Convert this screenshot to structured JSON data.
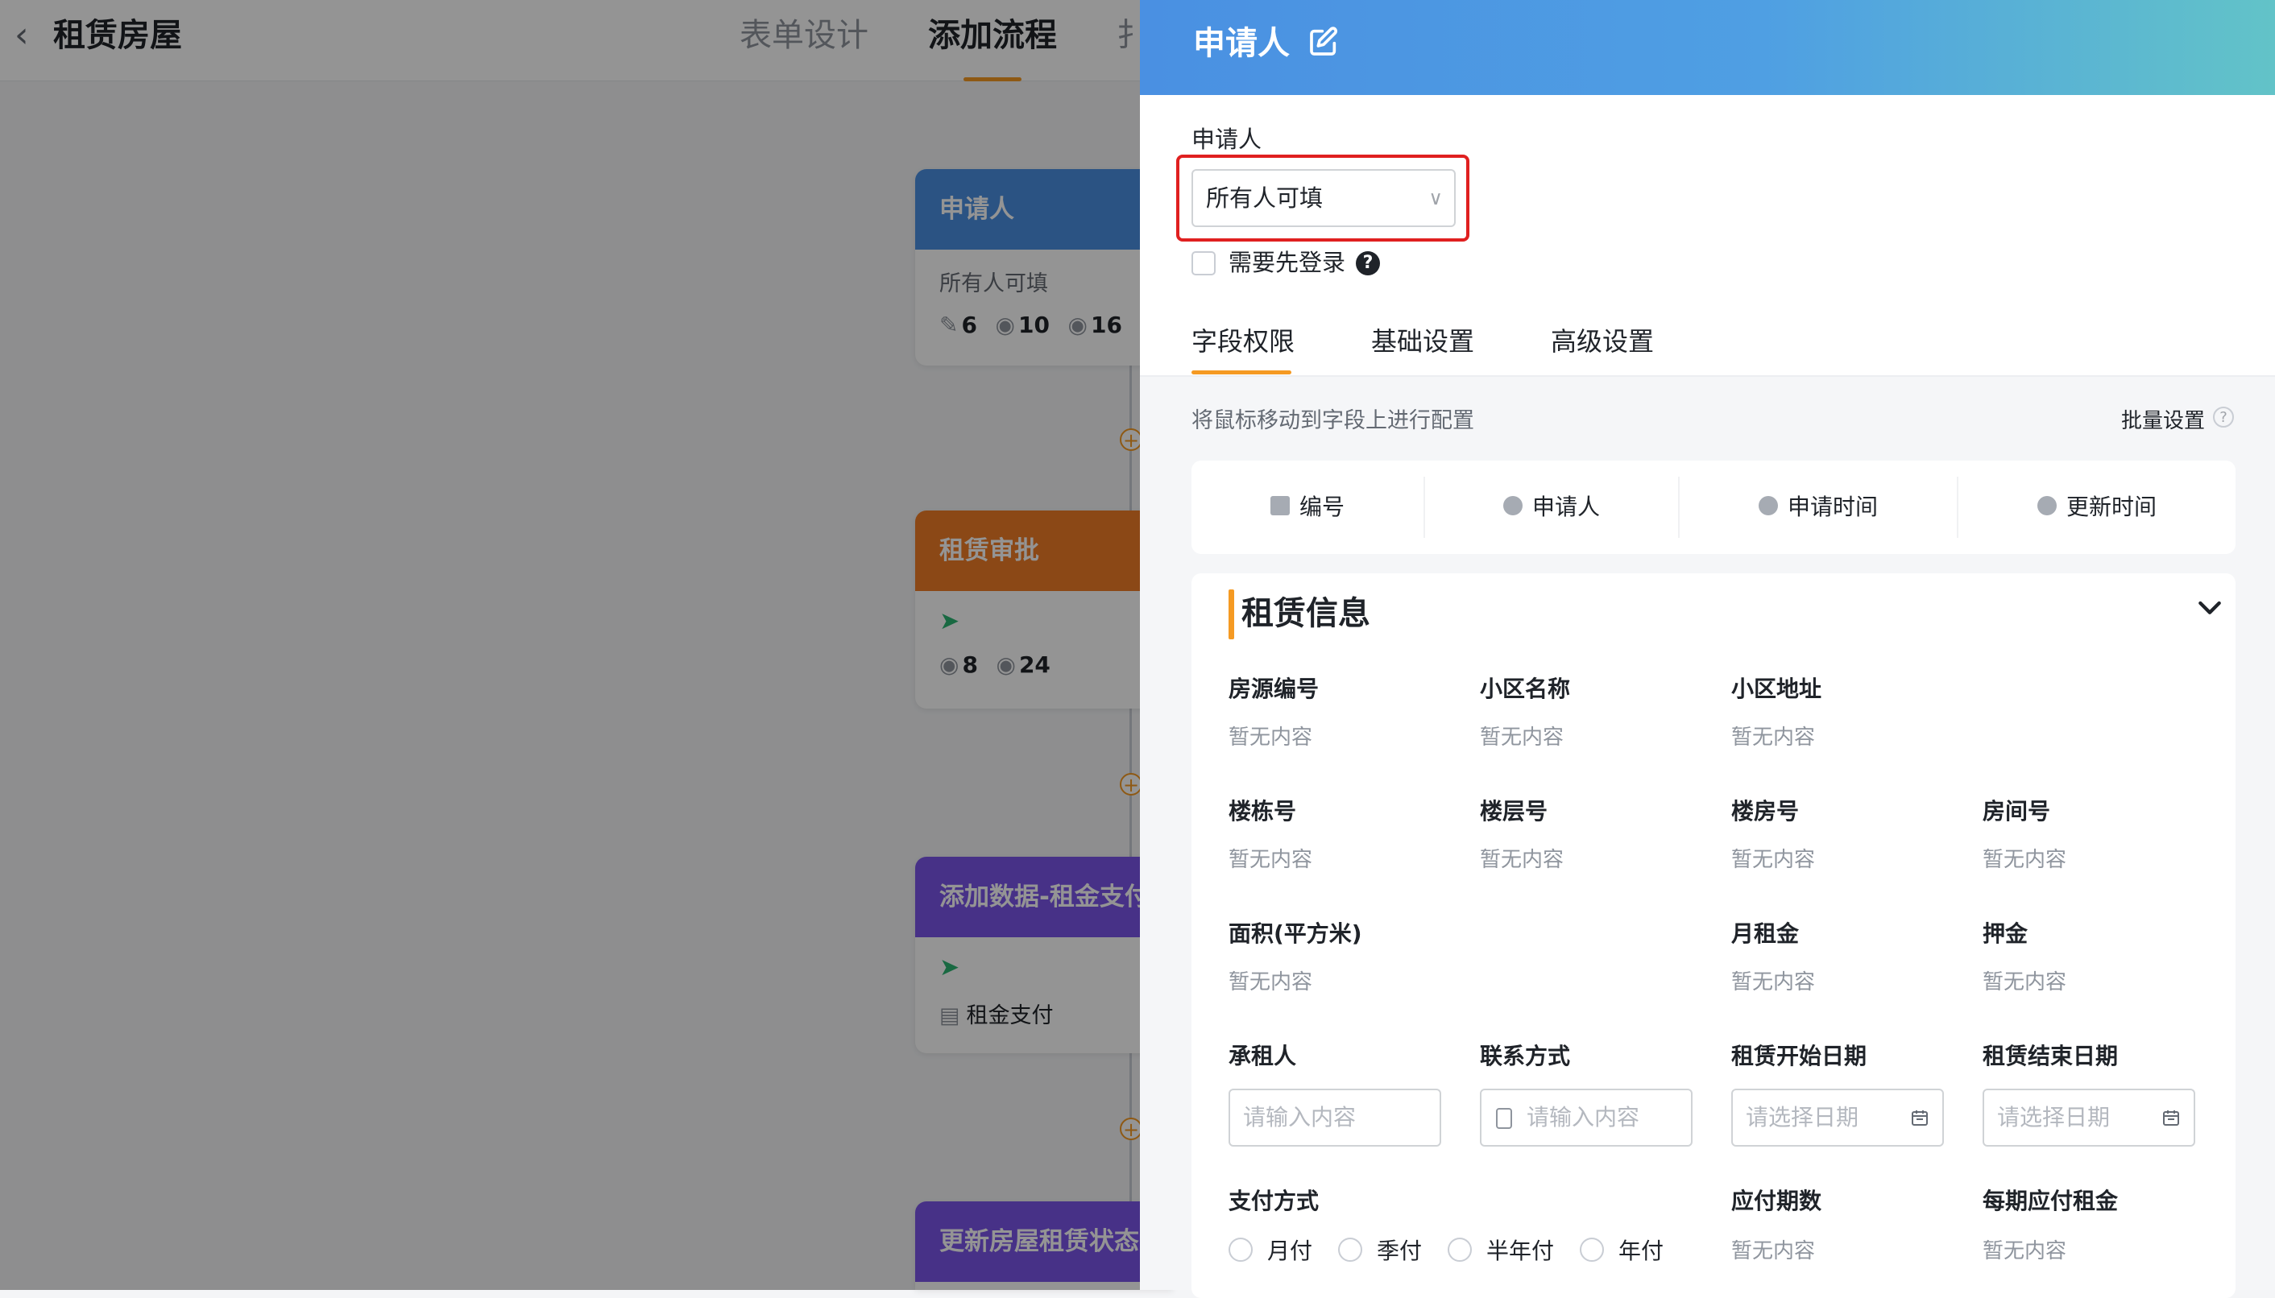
{
  "app": {
    "back_icon": "chevron-left-icon",
    "title": "租赁房屋"
  },
  "top_tabs": [
    "表单设计",
    "添加流程",
    "扌"
  ],
  "flow_nodes": [
    {
      "title": "申请人",
      "color": "#4a90e2",
      "subtitle": "所有人可填",
      "stats": [
        "6",
        "10",
        "16"
      ]
    },
    {
      "title": "租赁审批",
      "color": "#f07c27",
      "stats": [
        "8",
        "24"
      ]
    },
    {
      "title": "添加数据-租金支付",
      "color": "#7b55e8",
      "tag": "租金支付"
    },
    {
      "title": "更新房屋租赁状态",
      "color": "#7b55e8"
    }
  ],
  "panel": {
    "title": "申请人",
    "field_label": "申请人",
    "select_value": "所有人可填",
    "login_label": "需要先登录",
    "tabs": [
      "字段权限",
      "基础设置",
      "高级设置"
    ],
    "hint": "将鼠标移动到字段上进行配置",
    "batch_label": "批量设置",
    "system_fields": [
      "编号",
      "申请人",
      "申请时间",
      "更新时间"
    ],
    "section_title": "租赁信息",
    "empty_text": "暂无内容",
    "input_placeholder": "请输入内容",
    "date_placeholder": "请选择日期",
    "fields": {
      "house_no": "房源编号",
      "community_name": "小区名称",
      "community_address": "小区地址",
      "building_no": "楼栋号",
      "floor_no": "楼层号",
      "room_no": "楼房号",
      "chamber_no": "房间号",
      "area": "面积(平方米)",
      "monthly_rent": "月租金",
      "deposit": "押金",
      "tenant": "承租人",
      "contact": "联系方式",
      "start_date": "租赁开始日期",
      "end_date": "租赁结束日期",
      "payment_method": "支付方式",
      "periods": "应付期数",
      "rent_per_period": "每期应付租金"
    },
    "payment_options": [
      "月付",
      "季付",
      "半年付",
      "年付"
    ]
  },
  "colors": {
    "accent": "#f59a23",
    "highlight": "#e02020",
    "header_start": "#4a90e2",
    "header_end": "#62c3c8"
  }
}
